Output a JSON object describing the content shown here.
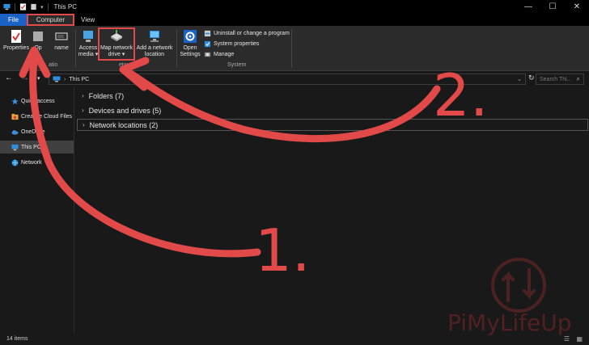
{
  "window": {
    "title": "This PC",
    "minimize": "—",
    "maximize": "☐",
    "close": "✕"
  },
  "tabs": {
    "file": "File",
    "computer": "Computer",
    "view": "View"
  },
  "ribbon": {
    "properties": "Properties",
    "open_partial": "Op",
    "rename_partial": "name",
    "location_label_partial": "Lo",
    "location_label_end": "atio",
    "access_media_1": "Access",
    "access_media_2": "media ▾",
    "map_drive_1": "Map network",
    "map_drive_2": "drive ▾",
    "add_location_1": "Add a network",
    "add_location_2": "location",
    "network_group": "Network",
    "network_group_partial": "etwork",
    "open_settings_1": "Open",
    "open_settings_2": "Settings",
    "uninstall": "Uninstall or change a program",
    "system_properties": "System properties",
    "manage": "Manage",
    "system_group": "System"
  },
  "address": {
    "path": "This PC",
    "search_placeholder": "Search Thi..."
  },
  "navpane": {
    "items": [
      {
        "label": "Quick access",
        "icon": "star-icon"
      },
      {
        "label": "Creative Cloud Files",
        "icon": "cloud-icon"
      },
      {
        "label": "OneDrive",
        "icon": "onedrive-icon"
      },
      {
        "label": "This PC",
        "icon": "pc-icon"
      },
      {
        "label": "Network",
        "icon": "network-icon"
      }
    ]
  },
  "content": {
    "groups": [
      {
        "label": "Folders (7)"
      },
      {
        "label": "Devices and drives (5)"
      },
      {
        "label": "Network locations (2)"
      }
    ]
  },
  "status": {
    "items_count": "14 items"
  },
  "annotations": {
    "step1": "1.",
    "step2": "2.",
    "color": "#e24a4a"
  },
  "watermark": {
    "text": "PiMyLifeUp"
  }
}
